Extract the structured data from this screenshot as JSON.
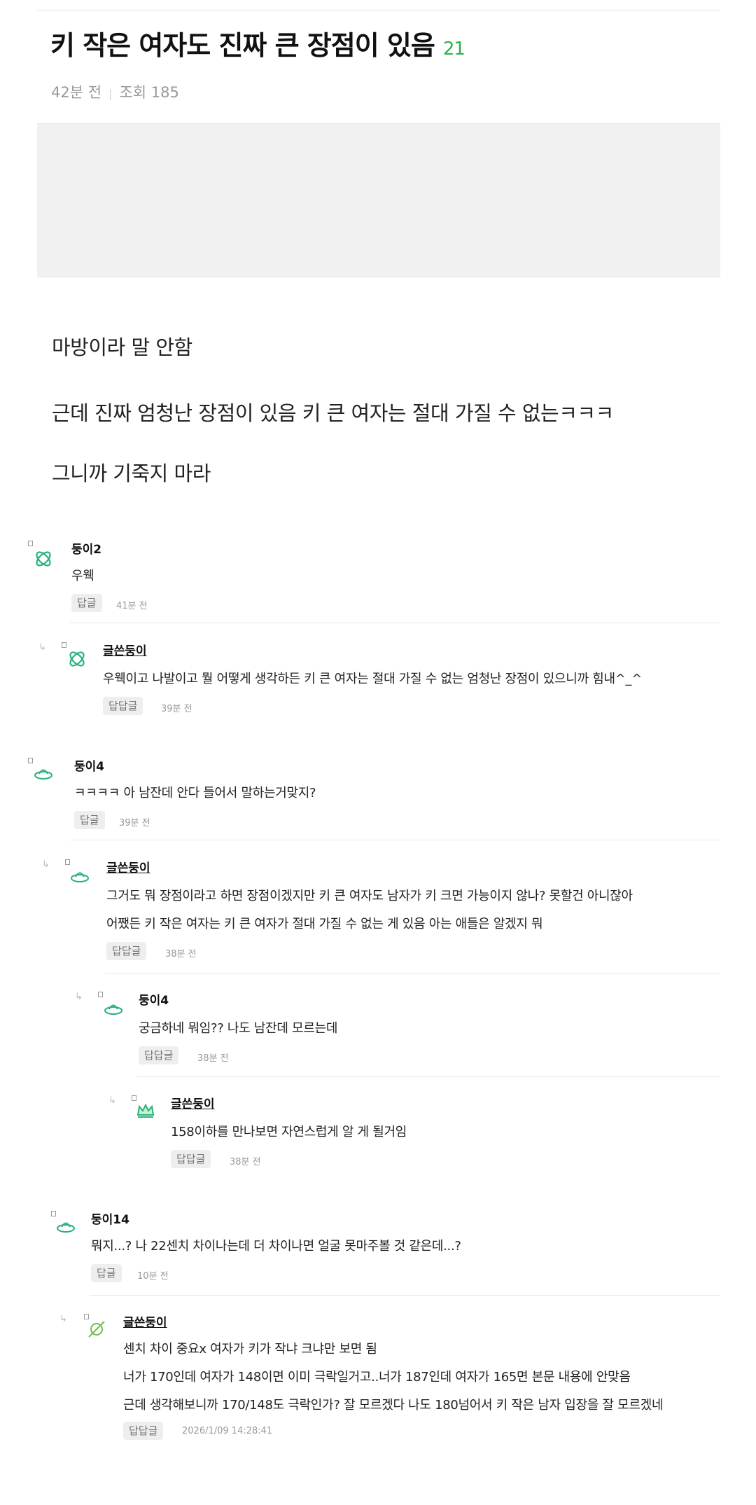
{
  "post": {
    "title": "키 작은 여자도 진짜 큰 장점이 있음",
    "comment_count": "21",
    "time": "42분 전",
    "separator": "|",
    "views": "조회 185",
    "body": [
      "마방이라 말 안함",
      "근데 진짜 엄청난 장점이 있음 키 큰 여자는 절대 가질 수 없는ㅋㅋㅋ",
      "그니까 기죽지 마라"
    ]
  },
  "comments": [
    {
      "name": "둥이2",
      "lines": [
        "우웩"
      ],
      "button": "답글",
      "time": "41분 전"
    },
    {
      "name": "글쓴둥이",
      "lines": [
        "우웩이고 나발이고 뭘 어떻게 생각하든 키 큰 여자는 절대 가질 수 없는 엄청난 장점이 있으니까 힘내^_^"
      ],
      "button": "답답글",
      "time": "39분 전"
    },
    {
      "name": "둥이4",
      "lines": [
        "ㅋㅋㅋㅋ 아 남잔데 안다 들어서 말하는거맞지?"
      ],
      "button": "답글",
      "time": "39분 전"
    },
    {
      "name": "글쓴둥이",
      "lines": [
        "그거도 뭐 장점이라고 하면 장점이겠지만 키 큰 여자도 남자가 키 크면 가능이지 않나? 못할건 아니잖아",
        "어쨌든 키 작은 여자는 키 큰 여자가 절대 가질 수 없는 게 있음 아는 애들은 알겠지 뭐"
      ],
      "button": "답답글",
      "time": "38분 전"
    },
    {
      "name": "둥이4",
      "lines": [
        "궁금하네 뭐임?? 나도 남잔데 모르는데"
      ],
      "button": "답답글",
      "time": "38분 전"
    },
    {
      "name": "글쓴둥이",
      "lines": [
        "158이하를 만나보면 자연스럽게 알 게 될거임"
      ],
      "button": "답답글",
      "time": "38분 전"
    },
    {
      "name": "둥이14",
      "lines": [
        "뭐지...? 나 22센치 차이나는데 더 차이나면 얼굴 못마주볼 것 같은데...?"
      ],
      "button": "답글",
      "time": "10분 전"
    },
    {
      "name": "글쓴둥이",
      "lines": [
        "센치 차이 중요x 여자가 키가 작냐 크냐만 보면 됨",
        "너가 170인데 여자가 148이면 이미 극락일거고..너가 187인데 여자가 165면 본문 내용에 안맞음",
        "근데 생각해보니까 170/148도 극락인가? 잘 모르겠다 나도 180넘어서 키 작은 남자 입장을 잘 모르겠네"
      ],
      "button": "답답글",
      "time": "2026/1/09 14:28:41"
    }
  ],
  "icons": {
    "reply_arrow": "reply-arrow-icon",
    "avatars": [
      "atom-icon",
      "atom-icon",
      "ufo-icon",
      "ufo-icon",
      "ufo-icon",
      "crown-icon",
      "ufo-icon",
      "planet-icon"
    ]
  },
  "colors": {
    "accent": "#2bb24c",
    "meta": "#999999",
    "button_bg": "#eeeeee"
  }
}
